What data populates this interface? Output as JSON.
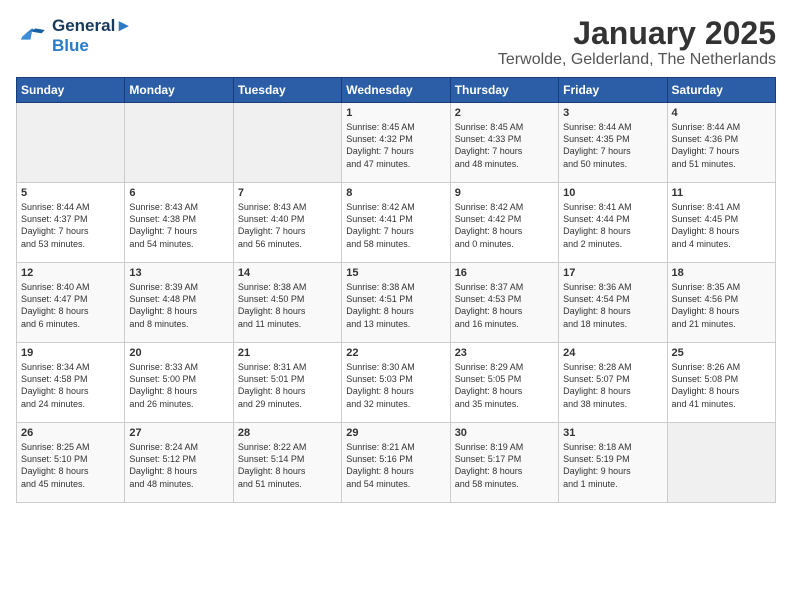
{
  "logo": {
    "line1": "General",
    "line2": "Blue"
  },
  "title": "January 2025",
  "location": "Terwolde, Gelderland, The Netherlands",
  "weekdays": [
    "Sunday",
    "Monday",
    "Tuesday",
    "Wednesday",
    "Thursday",
    "Friday",
    "Saturday"
  ],
  "weeks": [
    [
      {
        "day": "",
        "content": ""
      },
      {
        "day": "",
        "content": ""
      },
      {
        "day": "",
        "content": ""
      },
      {
        "day": "1",
        "content": "Sunrise: 8:45 AM\nSunset: 4:32 PM\nDaylight: 7 hours\nand 47 minutes."
      },
      {
        "day": "2",
        "content": "Sunrise: 8:45 AM\nSunset: 4:33 PM\nDaylight: 7 hours\nand 48 minutes."
      },
      {
        "day": "3",
        "content": "Sunrise: 8:44 AM\nSunset: 4:35 PM\nDaylight: 7 hours\nand 50 minutes."
      },
      {
        "day": "4",
        "content": "Sunrise: 8:44 AM\nSunset: 4:36 PM\nDaylight: 7 hours\nand 51 minutes."
      }
    ],
    [
      {
        "day": "5",
        "content": "Sunrise: 8:44 AM\nSunset: 4:37 PM\nDaylight: 7 hours\nand 53 minutes."
      },
      {
        "day": "6",
        "content": "Sunrise: 8:43 AM\nSunset: 4:38 PM\nDaylight: 7 hours\nand 54 minutes."
      },
      {
        "day": "7",
        "content": "Sunrise: 8:43 AM\nSunset: 4:40 PM\nDaylight: 7 hours\nand 56 minutes."
      },
      {
        "day": "8",
        "content": "Sunrise: 8:42 AM\nSunset: 4:41 PM\nDaylight: 7 hours\nand 58 minutes."
      },
      {
        "day": "9",
        "content": "Sunrise: 8:42 AM\nSunset: 4:42 PM\nDaylight: 8 hours\nand 0 minutes."
      },
      {
        "day": "10",
        "content": "Sunrise: 8:41 AM\nSunset: 4:44 PM\nDaylight: 8 hours\nand 2 minutes."
      },
      {
        "day": "11",
        "content": "Sunrise: 8:41 AM\nSunset: 4:45 PM\nDaylight: 8 hours\nand 4 minutes."
      }
    ],
    [
      {
        "day": "12",
        "content": "Sunrise: 8:40 AM\nSunset: 4:47 PM\nDaylight: 8 hours\nand 6 minutes."
      },
      {
        "day": "13",
        "content": "Sunrise: 8:39 AM\nSunset: 4:48 PM\nDaylight: 8 hours\nand 8 minutes."
      },
      {
        "day": "14",
        "content": "Sunrise: 8:38 AM\nSunset: 4:50 PM\nDaylight: 8 hours\nand 11 minutes."
      },
      {
        "day": "15",
        "content": "Sunrise: 8:38 AM\nSunset: 4:51 PM\nDaylight: 8 hours\nand 13 minutes."
      },
      {
        "day": "16",
        "content": "Sunrise: 8:37 AM\nSunset: 4:53 PM\nDaylight: 8 hours\nand 16 minutes."
      },
      {
        "day": "17",
        "content": "Sunrise: 8:36 AM\nSunset: 4:54 PM\nDaylight: 8 hours\nand 18 minutes."
      },
      {
        "day": "18",
        "content": "Sunrise: 8:35 AM\nSunset: 4:56 PM\nDaylight: 8 hours\nand 21 minutes."
      }
    ],
    [
      {
        "day": "19",
        "content": "Sunrise: 8:34 AM\nSunset: 4:58 PM\nDaylight: 8 hours\nand 24 minutes."
      },
      {
        "day": "20",
        "content": "Sunrise: 8:33 AM\nSunset: 5:00 PM\nDaylight: 8 hours\nand 26 minutes."
      },
      {
        "day": "21",
        "content": "Sunrise: 8:31 AM\nSunset: 5:01 PM\nDaylight: 8 hours\nand 29 minutes."
      },
      {
        "day": "22",
        "content": "Sunrise: 8:30 AM\nSunset: 5:03 PM\nDaylight: 8 hours\nand 32 minutes."
      },
      {
        "day": "23",
        "content": "Sunrise: 8:29 AM\nSunset: 5:05 PM\nDaylight: 8 hours\nand 35 minutes."
      },
      {
        "day": "24",
        "content": "Sunrise: 8:28 AM\nSunset: 5:07 PM\nDaylight: 8 hours\nand 38 minutes."
      },
      {
        "day": "25",
        "content": "Sunrise: 8:26 AM\nSunset: 5:08 PM\nDaylight: 8 hours\nand 41 minutes."
      }
    ],
    [
      {
        "day": "26",
        "content": "Sunrise: 8:25 AM\nSunset: 5:10 PM\nDaylight: 8 hours\nand 45 minutes."
      },
      {
        "day": "27",
        "content": "Sunrise: 8:24 AM\nSunset: 5:12 PM\nDaylight: 8 hours\nand 48 minutes."
      },
      {
        "day": "28",
        "content": "Sunrise: 8:22 AM\nSunset: 5:14 PM\nDaylight: 8 hours\nand 51 minutes."
      },
      {
        "day": "29",
        "content": "Sunrise: 8:21 AM\nSunset: 5:16 PM\nDaylight: 8 hours\nand 54 minutes."
      },
      {
        "day": "30",
        "content": "Sunrise: 8:19 AM\nSunset: 5:17 PM\nDaylight: 8 hours\nand 58 minutes."
      },
      {
        "day": "31",
        "content": "Sunrise: 8:18 AM\nSunset: 5:19 PM\nDaylight: 9 hours\nand 1 minute."
      },
      {
        "day": "",
        "content": ""
      }
    ]
  ]
}
